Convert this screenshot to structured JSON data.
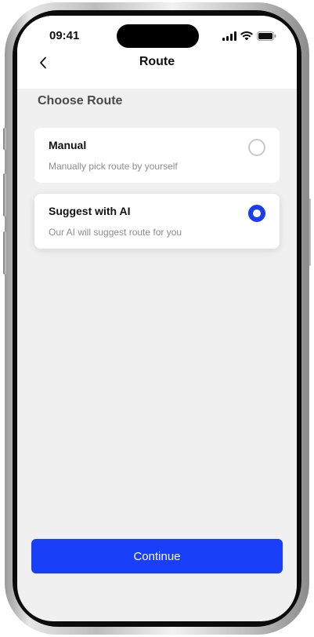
{
  "status": {
    "time": "09:41"
  },
  "header": {
    "title": "Route",
    "back_icon": "chevron-left-icon"
  },
  "section": {
    "title": "Choose Route"
  },
  "options": [
    {
      "title": "Manual",
      "description": "Manually pick route by yourself",
      "selected": false
    },
    {
      "title": "Suggest with AI",
      "description": "Our AI will suggest route for you",
      "selected": true
    }
  ],
  "footer": {
    "continue_label": "Continue"
  },
  "colors": {
    "accent": "#1A3FF8",
    "background": "#F0F0F0",
    "card": "#FFFFFF"
  }
}
